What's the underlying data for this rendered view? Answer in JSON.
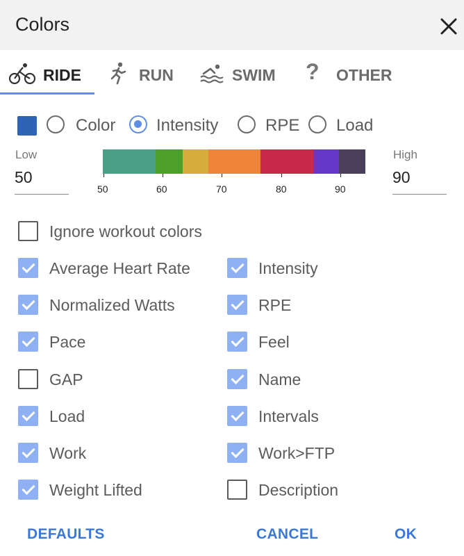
{
  "dialog": {
    "title": "Colors"
  },
  "tabs": [
    {
      "label": "RIDE",
      "icon": "bike-icon",
      "active": true
    },
    {
      "label": "RUN",
      "icon": "run-icon",
      "active": false
    },
    {
      "label": "SWIM",
      "icon": "swim-icon",
      "active": false
    },
    {
      "label": "OTHER",
      "icon": "question-icon",
      "active": false
    }
  ],
  "color_mode": {
    "swatch_color": "#2f63b4",
    "options": [
      {
        "label": "Color",
        "selected": false
      },
      {
        "label": "Intensity",
        "selected": true
      },
      {
        "label": "RPE",
        "selected": false
      },
      {
        "label": "Load",
        "selected": false
      }
    ]
  },
  "range": {
    "low_label": "Low",
    "low_value": "50",
    "high_label": "High",
    "high_value": "90",
    "ticks": [
      "50",
      "60",
      "70",
      "80",
      "90"
    ],
    "bands": [
      "#4aa087",
      "#4e9e2a",
      "#d4ad3c",
      "#ee8438",
      "#c92a4a",
      "#6438c8",
      "#4a3f5b"
    ]
  },
  "ignore": {
    "label": "Ignore workout colors",
    "checked": false
  },
  "fields_left": [
    {
      "label": "Average Heart Rate",
      "checked": true
    },
    {
      "label": "Normalized Watts",
      "checked": true
    },
    {
      "label": "Pace",
      "checked": true
    },
    {
      "label": "GAP",
      "checked": false
    },
    {
      "label": "Load",
      "checked": true
    },
    {
      "label": "Work",
      "checked": true
    },
    {
      "label": "Weight Lifted",
      "checked": true
    }
  ],
  "fields_right": [
    {
      "label": "Intensity",
      "checked": true
    },
    {
      "label": "RPE",
      "checked": true
    },
    {
      "label": "Feel",
      "checked": true
    },
    {
      "label": "Name",
      "checked": true
    },
    {
      "label": "Intervals",
      "checked": true
    },
    {
      "label": "Work>FTP",
      "checked": true
    },
    {
      "label": "Description",
      "checked": false
    }
  ],
  "buttons": {
    "defaults": "DEFAULTS",
    "cancel": "CANCEL",
    "ok": "OK"
  },
  "colors": {
    "accent": "#5f8ee8",
    "button_text": "#3c78d8"
  }
}
